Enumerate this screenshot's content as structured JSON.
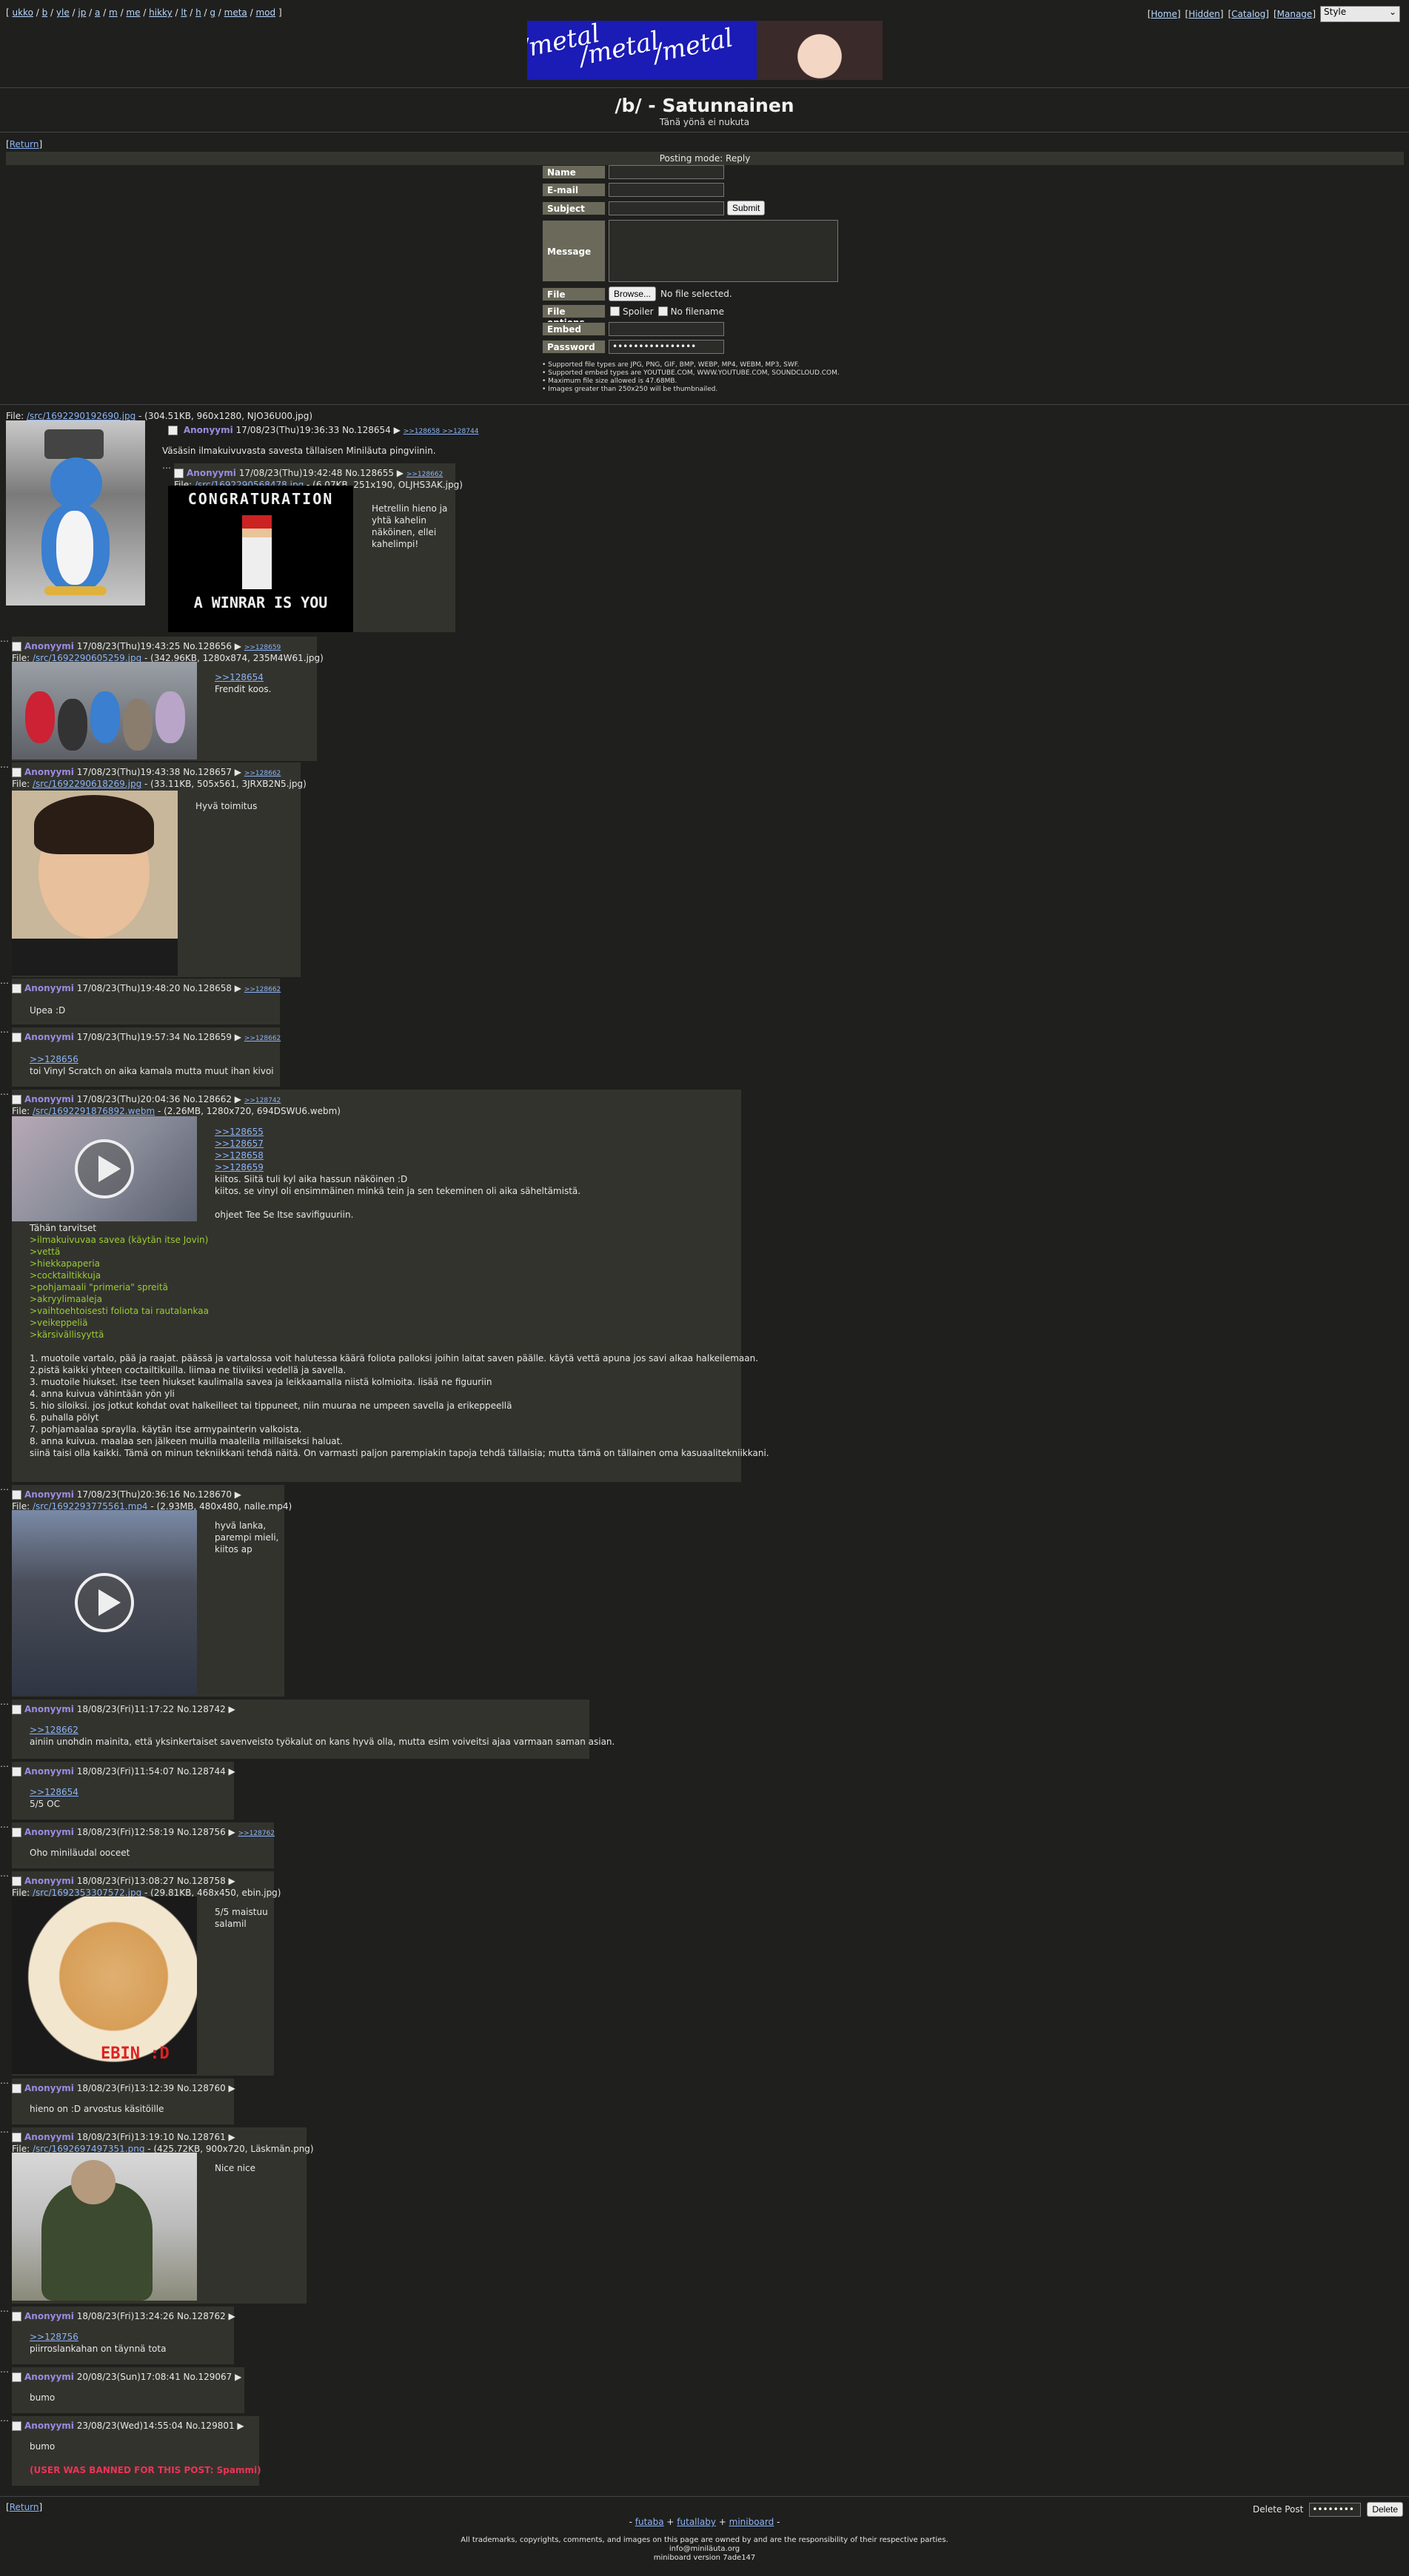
{
  "nav": {
    "boards": [
      "ukko",
      "b",
      "yle",
      "jp",
      "a",
      "m",
      "me",
      "hikky",
      "lt",
      "h",
      "g",
      "meta",
      "mod"
    ],
    "right_links": [
      "Home",
      "Hidden",
      "Catalog",
      "Manage"
    ],
    "style_select": "Style"
  },
  "banner": {
    "text": "/metal",
    "alt": "/metal /metal /metal"
  },
  "board": {
    "title": "/b/ - Satunnainen",
    "subtitle": "Tänä yönä ei nukuta"
  },
  "return_label": "Return",
  "posting_mode": "Posting mode: Reply",
  "form": {
    "name": "Name",
    "email": "E-mail",
    "subject": "Subject",
    "submit": "Submit",
    "message": "Message",
    "file": "File",
    "browse": "Browse...",
    "no_file": "No file selected.",
    "file_options": "File options",
    "spoiler": "Spoiler",
    "no_filename": "No filename",
    "embed": "Embed",
    "password": "Password",
    "password_value": "••••••••••••••••",
    "rules": [
      "Supported file types are JPG, PNG, GIF, BMP, WEBP, MP4, WEBM, MP3, SWF.",
      "Supported embed types are YOUTUBE.COM, WWW.YOUTUBE.COM, SOUNDCLOUD.COM.",
      "Maximum file size allowed is 47.68MB.",
      "Images greater than 250x250 will be thumbnailed."
    ]
  },
  "op": {
    "file_label": "File:",
    "file_link": "/src/1692290192690.jpg",
    "file_info": "- (304.51KB, 960x1280, NJO36U00.jpg)",
    "name": "Anonyymi",
    "date": "17/08/23(Thu)19:36:33",
    "no": "No.128654",
    "backlinks": ">>128658 >>128744",
    "message": "Väsäsin ilmakuivuvasta savesta tällaisen Miniläuta pingviinin."
  },
  "posts": [
    {
      "name": "Anonyymi",
      "date": "17/08/23(Thu)19:42:48",
      "no": "No.128655",
      "backlinks": ">>128662",
      "file_link": "/src/1692290568478.jpg",
      "file_info": "- (6.07KB, 251x190, OLJHS3AK.jpg)",
      "lines": [
        "Hetrellin hieno ja",
        "yhtä kahelin",
        "näköinen, ellei",
        "kahelimpi!"
      ]
    },
    {
      "name": "Anonyymi",
      "date": "17/08/23(Thu)19:43:25",
      "no": "No.128656",
      "backlinks": ">>128659",
      "file_link": "/src/1692290605259.jpg",
      "file_info": "- (342.96KB, 1280x874, 235M4W61.jpg)",
      "quotes": [
        ">>128654"
      ],
      "lines": [
        "Frendit koos."
      ]
    },
    {
      "name": "Anonyymi",
      "date": "17/08/23(Thu)19:43:38",
      "no": "No.128657",
      "backlinks": ">>128662",
      "file_link": "/src/1692290618269.jpg",
      "file_info": "- (33.11KB, 505x561, 3JRXB2N5.jpg)",
      "lines": [
        "Hyvä toimitus"
      ]
    },
    {
      "name": "Anonyymi",
      "date": "17/08/23(Thu)19:48:20",
      "no": "No.128658",
      "backlinks": ">>128662",
      "lines": [
        "Upea :D"
      ]
    },
    {
      "name": "Anonyymi",
      "date": "17/08/23(Thu)19:57:34",
      "no": "No.128659",
      "backlinks": ">>128662",
      "quotes": [
        ">>128656"
      ],
      "lines": [
        "toi Vinyl Scratch on aika kamala mutta muut ihan kivoi"
      ]
    },
    {
      "name": "Anonyymi",
      "date": "17/08/23(Thu)20:04:36",
      "no": "No.128662",
      "backlinks": ">>128742",
      "file_link": "/src/1692291876892.webm",
      "file_info": "- (2.26MB, 1280x720, 694DSWU6.webm)",
      "quotes": [
        ">>128655",
        ">>128657",
        ">>128658",
        ">>128659"
      ],
      "side_lines": [
        "kiitos. Siitä tuli kyl aika hassun näköinen :D",
        "kiitos. se vinyl oli ensimmäinen minkä tein ja sen tekeminen oli aika säheltämistä.",
        "",
        "ohjeet Tee Se Itse savifiguuriin."
      ],
      "intro": "Tähän tarvitset",
      "greentext": [
        ">ilmakuivuvaa savea (käytän itse Jovin)",
        ">vettä",
        ">hiekkapaperia",
        ">cocktailtikkuja",
        ">pohjamaali \"primeria\" spreitä",
        ">akryylimaaleja",
        ">vaihtoehtoisesti foliota tai rautalankaa",
        ">veikeppeliä",
        ">kärsivällisyyttä"
      ],
      "steps": [
        "1. muotoile vartalo, pää ja raajat. päässä ja vartalossa voit halutessa käärä foliota palloksi joihin laitat saven päälle. käytä vettä apuna jos savi alkaa halkeilemaan.",
        "2.pistä kaikki yhteen coctailtikuilla. liimaa ne tiiviiksi vedellä ja savella.",
        "3. muotoile hiukset. itse teen hiukset kaulimalla savea ja leikkaamalla niistä kolmioita. lisää ne figuuriin",
        "4. anna kuivua vähintään yön yli",
        "5. hio siloiksi. jos jotkut kohdat ovat halkeilleet tai tippuneet, niin muuraa ne umpeen savella ja erikeppeellä",
        "6. puhalla pölyt",
        "7. pohjamaalaa spraylla. käytän itse armypainterin valkoista.",
        "8. anna kuivua. maalaa sen jälkeen muilla maaleilla millaiseksi haluat.",
        "siinä taisi olla kaikki. Tämä on minun tekniikkani tehdä näitä. On varmasti paljon parempiakin tapoja tehdä tällaisia; mutta tämä on tällainen oma kasuaalitekniikkani."
      ]
    },
    {
      "name": "Anonyymi",
      "date": "17/08/23(Thu)20:36:16",
      "no": "No.128670",
      "file_link": "/src/1692293775561.mp4",
      "file_info": "- (2.93MB, 480x480, nalle.mp4)",
      "lines": [
        "hyvä lanka,",
        "parempi mieli,",
        "kiitos ap"
      ]
    },
    {
      "name": "Anonyymi",
      "date": "18/08/23(Fri)11:17:22",
      "no": "No.128742",
      "quotes": [
        ">>128662"
      ],
      "lines": [
        "ainiin unohdin mainita, että yksinkertaiset savenveisto työkalut on kans hyvä olla, mutta esim voiveitsi ajaa varmaan saman asian."
      ]
    },
    {
      "name": "Anonyymi",
      "date": "18/08/23(Fri)11:54:07",
      "no": "No.128744",
      "quotes": [
        ">>128654"
      ],
      "lines": [
        "5/5 OC"
      ]
    },
    {
      "name": "Anonyymi",
      "date": "18/08/23(Fri)12:58:19",
      "no": "No.128756",
      "backlinks": ">>128762",
      "lines": [
        "Oho miniläudal ooceet"
      ]
    },
    {
      "name": "Anonyymi",
      "date": "18/08/23(Fri)13:08:27",
      "no": "No.128758",
      "file_link": "/src/1692353307572.jpg",
      "file_info": "- (29.81KB, 468x450, ebin.jpg)",
      "lines": [
        "5/5 maistuu",
        "salamil"
      ]
    },
    {
      "name": "Anonyymi",
      "date": "18/08/23(Fri)13:12:39",
      "no": "No.128760",
      "lines": [
        "hieno on :D arvostus käsitöille"
      ]
    },
    {
      "name": "Anonyymi",
      "date": "18/08/23(Fri)13:19:10",
      "no": "No.128761",
      "file_link": "/src/1692697497351.png",
      "file_info": "- (425.72KB, 900x720, Läskmän.png)",
      "lines": [
        "Nice nice"
      ]
    },
    {
      "name": "Anonyymi",
      "date": "18/08/23(Fri)13:24:26",
      "no": "No.128762",
      "quotes": [
        ">>128756"
      ],
      "lines": [
        "piirroslankahan on täynnä tota"
      ]
    },
    {
      "name": "Anonyymi",
      "date": "20/08/23(Sun)17:08:41",
      "no": "No.129067",
      "lines": [
        "bumo"
      ]
    },
    {
      "name": "Anonyymi",
      "date": "23/08/23(Wed)14:55:04",
      "no": "No.129801",
      "lines": [
        "bumo"
      ],
      "ban": "(USER WAS BANNED FOR THIS POST: Spammi)"
    }
  ],
  "thumb_texts": {
    "congrats_top": "CONGRATURATION",
    "congrats_bottom": "A WINRAR IS YOU",
    "ebin": "EBIN :D"
  },
  "footer": {
    "delete_post": "Delete Post",
    "delete_btn": "Delete",
    "password_value": "••••••••",
    "links": [
      "futaba",
      "futallaby",
      "miniboard"
    ],
    "legal": "All trademarks, copyrights, comments, and images on this page are owned by and are the responsibility of their respective parties.",
    "email": "info@miniläuta.org",
    "version": "miniboard version 7ade147"
  }
}
